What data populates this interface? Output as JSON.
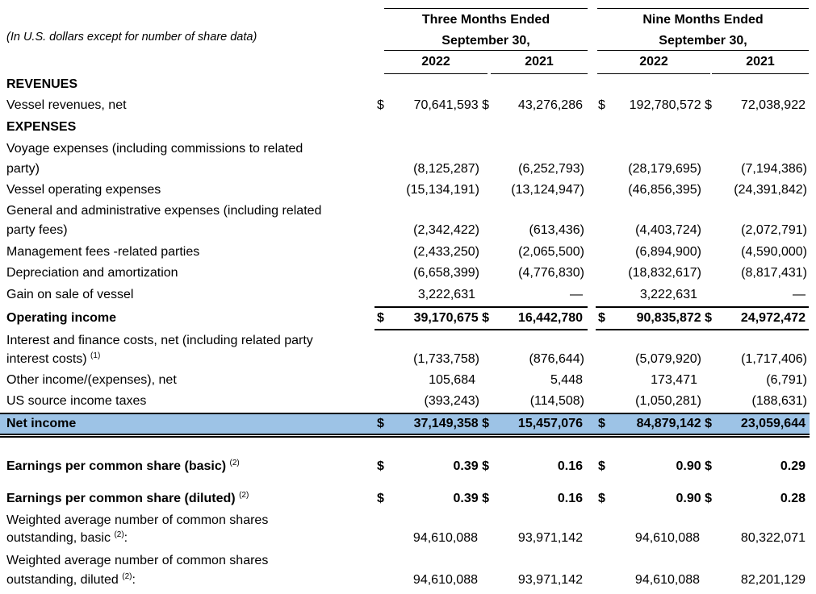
{
  "header": {
    "note": "(In U.S. dollars except for number of share data)",
    "group1_line1": "Three Months Ended",
    "group1_line2": "September 30,",
    "group2_line1": "Nine Months Ended",
    "group2_line2": "September 30,",
    "years": [
      "2022",
      "2021",
      "2022",
      "2021"
    ]
  },
  "dollar_sign": "$",
  "sections": {
    "revenues": "REVENUES",
    "expenses": "EXPENSES"
  },
  "rows": {
    "vessel_revenues": {
      "label": "Vessel revenues, net",
      "values": [
        "70,641,593",
        "43,276,286",
        "192,780,572",
        "72,038,922"
      ]
    },
    "voyage_expenses": {
      "label1": "Voyage expenses (including commissions to related",
      "label2": "party)",
      "values": [
        "(8,125,287)",
        "(6,252,793)",
        "(28,179,695)",
        "(7,194,386)"
      ]
    },
    "vessel_operating": {
      "label": "Vessel operating expenses",
      "values": [
        "(15,134,191)",
        "(13,124,947)",
        "(46,856,395)",
        "(24,391,842)"
      ]
    },
    "general_admin": {
      "label1": "General and administrative expenses (including related",
      "label2": "party fees)",
      "values": [
        "(2,342,422)",
        "(613,436)",
        "(4,403,724)",
        "(2,072,791)"
      ]
    },
    "management_fees": {
      "label": "Management fees -related parties",
      "values": [
        "(2,433,250)",
        "(2,065,500)",
        "(6,894,900)",
        "(4,590,000)"
      ]
    },
    "depreciation": {
      "label": "Depreciation and amortization",
      "values": [
        "(6,658,399)",
        "(4,776,830)",
        "(18,832,617)",
        "(8,817,431)"
      ]
    },
    "gain_sale": {
      "label": "Gain on sale of vessel",
      "values": [
        "3,222,631",
        "—",
        "3,222,631",
        "—"
      ]
    },
    "operating_income": {
      "label": "Operating income",
      "values": [
        "39,170,675",
        "16,442,780",
        "90,835,872",
        "24,972,472"
      ]
    },
    "interest": {
      "label1": "Interest and finance costs, net (including related party",
      "label2": "interest costs)",
      "footnote": "(1)",
      "values": [
        "(1,733,758)",
        "(876,644)",
        "(5,079,920)",
        "(1,717,406)"
      ]
    },
    "other_income": {
      "label": "Other income/(expenses), net",
      "values": [
        "105,684",
        "5,448",
        "173,471",
        "(6,791)"
      ]
    },
    "us_taxes": {
      "label": "US source income taxes",
      "values": [
        "(393,243)",
        "(114,508)",
        "(1,050,281)",
        "(188,631)"
      ]
    },
    "net_income": {
      "label": "Net income",
      "values": [
        "37,149,358",
        "15,457,076",
        "84,879,142",
        "23,059,644"
      ]
    },
    "eps_basic": {
      "label": "Earnings per common share (basic)",
      "footnote": "(2)",
      "values": [
        "0.39",
        "0.16",
        "0.90",
        "0.29"
      ]
    },
    "eps_diluted": {
      "label": "Earnings per common share (diluted)",
      "footnote": "(2)",
      "values": [
        "0.39",
        "0.16",
        "0.90",
        "0.28"
      ]
    },
    "wavg_basic": {
      "label1": "Weighted average number of common shares",
      "label2": "outstanding, basic",
      "footnote": "(2)",
      "suffix": ":",
      "values": [
        "94,610,088",
        "93,971,142",
        "94,610,088",
        "80,322,071"
      ]
    },
    "wavg_diluted": {
      "label1": "Weighted average number of common shares",
      "label2": "outstanding, diluted",
      "footnote": "(2)",
      "suffix": ":",
      "values": [
        "94,610,088",
        "93,971,142",
        "94,610,088",
        "82,201,129"
      ]
    }
  },
  "colors": {
    "highlight": "#9dc3e6"
  }
}
